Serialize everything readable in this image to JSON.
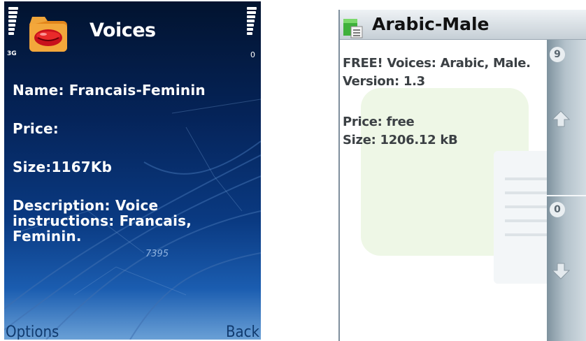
{
  "left_screen": {
    "status": {
      "network": "3G",
      "battery_label": "0"
    },
    "title": "Voices",
    "name_line": "Name: Francais-Feminin",
    "price_line": "Price:",
    "size_line": "Size:1167Kb",
    "description_line": "Description: Voice instructions: Francais, Feminin.",
    "softkeys": {
      "left": "Options",
      "right": "Back"
    },
    "map_label": "7395",
    "colors": {
      "background_top": "#02132f",
      "background_bottom": "#6aa0d6",
      "text": "#ffffff"
    },
    "icons": [
      "signal-icon",
      "battery-icon",
      "lips-folder-icon"
    ]
  },
  "right_screen": {
    "title": "Arabic-Male",
    "line1": "FREE! Voices: Arabic, Male.",
    "line2": "Version: 1.3",
    "line3": "Price: free",
    "line4": "Size: 1206.12 kB",
    "scroll": {
      "top_number": "9",
      "bottom_number": "0"
    },
    "colors": {
      "header": "#c6cfd6",
      "scrollbar": "#8fa3b0",
      "text": "#3b4044"
    },
    "icons": [
      "file-icon",
      "scroll-up-arrow-icon",
      "scroll-down-arrow-icon"
    ]
  }
}
